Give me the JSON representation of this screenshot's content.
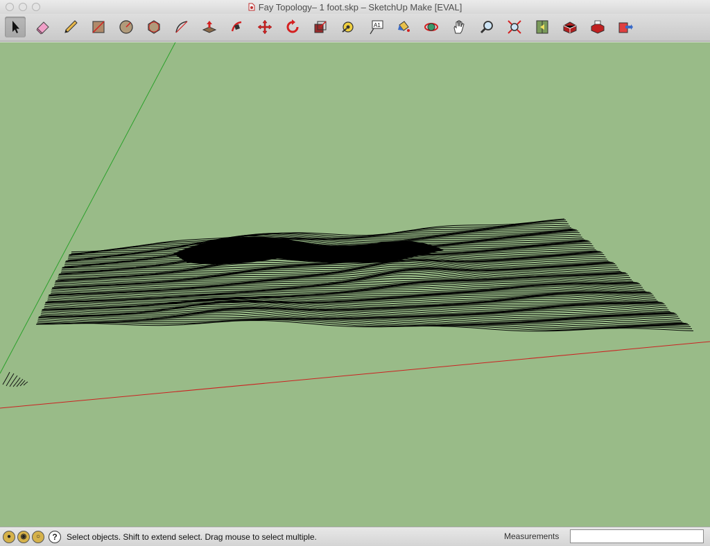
{
  "window": {
    "title": "Fay Topology– 1 foot.skp – SketchUp Make [EVAL]"
  },
  "toolbar": {
    "tools": [
      {
        "id": "select",
        "icon": "select-arrow-icon",
        "active": true
      },
      {
        "id": "eraser",
        "icon": "eraser-icon"
      },
      {
        "id": "pencil",
        "icon": "pencil-line-icon"
      },
      {
        "id": "rectangle",
        "icon": "rectangle-icon"
      },
      {
        "id": "circle",
        "icon": "circle-icon"
      },
      {
        "id": "polygon",
        "icon": "polygon-icon"
      },
      {
        "id": "arc",
        "icon": "arc-icon"
      },
      {
        "id": "push-pull",
        "icon": "push-pull-icon"
      },
      {
        "id": "follow-me",
        "icon": "follow-me-icon"
      },
      {
        "id": "move",
        "icon": "move-arrows-icon"
      },
      {
        "id": "rotate",
        "icon": "rotate-icon"
      },
      {
        "id": "scale",
        "icon": "scale-icon"
      },
      {
        "id": "tape-measure",
        "icon": "tape-measure-icon"
      },
      {
        "id": "text",
        "icon": "text-label-icon",
        "text": "A1"
      },
      {
        "id": "paint-bucket",
        "icon": "paint-bucket-icon"
      },
      {
        "id": "orbit",
        "icon": "orbit-icon"
      },
      {
        "id": "pan",
        "icon": "pan-hand-icon"
      },
      {
        "id": "zoom",
        "icon": "zoom-magnifier-icon"
      },
      {
        "id": "zoom-extents",
        "icon": "zoom-extents-icon"
      },
      {
        "id": "previous-view",
        "icon": "previous-view-icon"
      },
      {
        "id": "3d-warehouse",
        "icon": "3d-warehouse-icon"
      },
      {
        "id": "share-model",
        "icon": "share-model-icon"
      },
      {
        "id": "extension-warehouse",
        "icon": "extension-warehouse-icon"
      }
    ]
  },
  "colors": {
    "viewport_background": "#99bb88",
    "green_axis": "#2aa02a",
    "red_axis": "#cc2020",
    "contour_lines": "#000000",
    "tool_accent_red": "#d42020"
  },
  "statusbar": {
    "icons": [
      "geo-location-icon",
      "credits-icon",
      "user-icon"
    ],
    "help_icon": "help-question-icon",
    "help_glyph": "?",
    "message": "Select objects. Shift to extend select. Drag mouse to select multiple.",
    "measurements_label": "Measurements",
    "measurements_value": ""
  }
}
